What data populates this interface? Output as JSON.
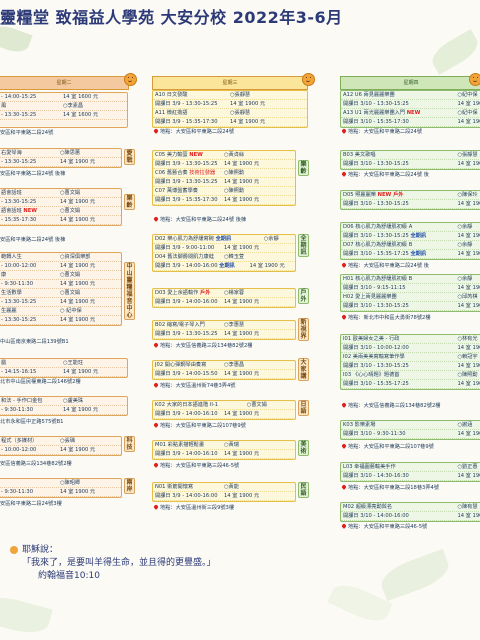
{
  "header": {
    "title": "靈糧堂  致福益人學苑  大安分校  2022年3-6月"
  },
  "columns": [
    {
      "header": "星期二"
    },
    {
      "header": "星期三"
    },
    {
      "header": "星期四"
    }
  ],
  "tuesday": {
    "c1": [
      "- 14:00-15:25",
      "14 室 1600 元"
    ],
    "c1b": [
      "風",
      "○李素昌"
    ],
    "c1c": [
      "- 13:30-15:25",
      "14 室 1600 元"
    ],
    "c1loc": "安區和平東路二段24號",
    "c2": [
      "右愛琴海",
      "○陳思蕙"
    ],
    "c2b": [
      "- 13:30-15:25",
      "14 室 1900 元"
    ],
    "c2loc": "安區和平東路二段24號  後棟",
    "c2side": "愛戰",
    "c3": [
      "語會話班",
      "○曹文娟"
    ],
    "c3b": [
      "- 13:30-15:25",
      "14 室 1900 元"
    ],
    "c3c": [
      "語會話班",
      "○曹文娟"
    ],
    "c3new": "NEW",
    "c3d": [
      "- 15:35-17:30",
      "14 室 1900 元"
    ],
    "c3loc": "安區和平東路二段24號  後棟",
    "c3side": "樂齡",
    "c4": [
      "範轉人生",
      "○資深俱樂部"
    ],
    "c4b": [
      "- 10:00-12:00",
      "14 室 1900 元"
    ],
    "c4c": [
      "康",
      "○曹文娟"
    ],
    "c4d": [
      "- 9:30-11:30",
      "14 室 1900 元"
    ],
    "c4e": [
      "生活數學",
      "○曹文娟"
    ],
    "c4f": [
      "- 13:30-15:25",
      "14 室 1900 元"
    ],
    "c4g": [
      "生麗麗",
      "○ 紀中保"
    ],
    "c4h": [
      "- 13:30-15:25",
      "14 室 1900 元"
    ],
    "c4loc": "中山區南京東路二段139號B1",
    "c4side": "中山靈糧福音中心",
    "c5": [
      "戲",
      "○王能玨"
    ],
    "c5b": [
      "- 14:15-16:15",
      "14 室 1900 元"
    ],
    "c5loc": "北市中山區民權東路二段146號2樓",
    "c6": [
      "和法 - 手作口金包",
      "○盧美珠"
    ],
    "c6b": [
      "- 9:30-11:30",
      "14 室 1900 元"
    ],
    "c6loc": "北市永和區中正路575號B1",
    "c7": [
      "程式（多媒材）",
      "○張瑀"
    ],
    "c7b": [
      "- 10:00-12:00",
      "14 室 1900 元"
    ],
    "c7loc": "安區信義路三段134巷82號2樓",
    "c7side": "科技",
    "c8": [
      "",
      "○陳昭卿"
    ],
    "c8b": [
      "- 9:30-11:30",
      "14 室 1900 元"
    ],
    "c8loc": "安區和平東路二段24號3樓",
    "c8side": "兩岸"
  },
  "wednesday": {
    "a10": [
      "A10 日文發酸",
      "○張靜慧"
    ],
    "a10b": [
      "開課日 3/9 - 13:30-15:25",
      "14 室 1900 元"
    ],
    "a11": [
      "A11 微紅擔語",
      "○張靜慧"
    ],
    "a11b": [
      "開課日 3/9 - 15:35-17:30",
      "14 室 1900 元"
    ],
    "aloc": "地點：大安區和平東路二段24號",
    "c05": [
      "C05 美力輸蛋 ",
      "○黃貞絲"
    ],
    "c05new": "NEW",
    "c05b": [
      "開課日 3/9 - 13:30-15:25",
      "14 室 1900 元"
    ],
    "c06": [
      "C06 舊藝合奏 ",
      "○陳照勳"
    ],
    "c06tag": "技術拉發器",
    "c06b": [
      "開課日 3/9 - 13:30-15:25",
      "14 室 1900 元"
    ],
    "c07": [
      "C07 萬博盤蓄學奏",
      "○陳照勳"
    ],
    "c07b": [
      "開課日 3/9 - 15:35-17:30",
      "14 室 1900 元"
    ],
    "cloc": "地點：大安區和平東路二段24號  後棟",
    "cside": "樂齡",
    "d02": [
      "D02 樂心肌力為舒緩寫碗 ",
      "○余靜"
    ],
    "d02tag": "全期訊",
    "d02b": [
      "開課日 3/9 - 9:00-11:00",
      "14 室 1900 元"
    ],
    "d04": [
      "D04 舊法腳爵閱肌力康蛙 ",
      "○韓玉萱"
    ],
    "d04b": [
      "開課日 3/9 - 14:00-16:00 ",
      "14 室 1900 元"
    ],
    "d04tag": "全期訊",
    "dside": "全期訊",
    "d03": [
      "D03 愛上余語輸作 ",
      "○楊家蓉"
    ],
    "d03tag": "戶外",
    "d03b": [
      "開課日 3/9 - 14:00-16:00",
      "14 室 1900 元"
    ],
    "d03side": "戶外",
    "b02": [
      "B02 縮寫/電子琴入門",
      "○李惠慧"
    ],
    "b02b": [
      "開課日 3/9 - 13:30-15:25",
      "14 室 1900 元"
    ],
    "bloc": "地點：大安區信義路三段134巷82號2樓",
    "bside": "新視界",
    "j02": [
      "J02 開心彈鋼琴由奏寫",
      "○李惠昌"
    ],
    "j02b": [
      "開課日 3/9 - 14:00-15:50",
      "14 室 1900 元"
    ],
    "jloc": "地點：大安區溫州街74巷3弄4號",
    "jside": "大家講",
    "k02": [
      "K02 大家的日本語進階 II-1",
      "○曹文娟"
    ],
    "k02b": [
      "開課日 3/9 - 14:00-16:10",
      "14 室 1900 元"
    ],
    "kloc": "地點：大安區和平東路二段107巷9號",
    "kside": "日語",
    "m01": [
      "M01 彩點素描輕鬆畫",
      "○黃瑞"
    ],
    "m01b": [
      "開課日 3/9 - 14:00-16:10",
      "14 室 1900 元"
    ],
    "mloc": "地點：大安區和平東路三段46-5號",
    "mside": "美術",
    "n01": [
      "N01 衛筋開懷寫",
      "○黃能"
    ],
    "n01b": [
      "開課日 3/9 - 14:00-16:00",
      "14 室 1900 元"
    ],
    "nloc": "地點：大安區溫州街三段9號3樓",
    "nside": "民語"
  },
  "thursday": {
    "a12": [
      "A12 U6 兩見麗麗樂團",
      "○紀中保"
    ],
    "a12b": [
      "開課日 3/10 - 13:30-15:25",
      "14 室 1900"
    ],
    "a13": [
      "A13 U1 兩光麗麗樂團入門 ",
      "○紀中保"
    ],
    "a13new": "NEW",
    "a13b": [
      "開課日 3/10 - 15:35-17:30",
      "14 室 1900"
    ],
    "aloc": "地點：大安區和平東路二段24號",
    "b03": [
      "B03 美文歌唱",
      "○張靜慧"
    ],
    "b03b": [
      "開課日 3/10 - 13:30-15:25",
      "14 室 1900"
    ],
    "bloc": "地點：大安區和平東路二段24號  後",
    "d05": [
      "D05 照麗麗樂 ",
      "○陳保玲"
    ],
    "d05new": "NEW  戶外",
    "d05b": [
      "開課日 3/10 - 13:30-15:25",
      "14 室 1900"
    ],
    "d06": [
      "D06 核心肌力為舒緩肌初級 A",
      "○余靜"
    ],
    "d06b": [
      "開課日 3/10 - 13:30-15:25 ",
      "14 室 1900"
    ],
    "d06tag": "全期訊",
    "d07": [
      "D07 核心肌力為舒緩肌初級 B",
      "○余靜"
    ],
    "d07b": [
      "開課日 3/10 - 15:35-17:25 ",
      "14 室 1900"
    ],
    "d07tag": "全期訊",
    "dloc": "地點：大安區和平東路二段24號  後",
    "h01": [
      "H01 核心肌力為舒緩肌初級 B",
      "○余靜"
    ],
    "h01b": [
      "開課日 3/10 - 9:15-11:15",
      "14 室 1900"
    ],
    "h02": [
      "H02 愛上兩見麗麗樂團",
      "○邱芮棋"
    ],
    "h02b": [
      "開課日 3/10 - 13:30-15:25",
      "14 室 1900"
    ],
    "hloc": "地點：新北市中和區大勇街78號2樓",
    "i01": [
      "I01 歐美婦女之美 - 行政",
      "○林有光"
    ],
    "i01b": [
      "開課日 3/10 - 10:00-12:00",
      "14 室 190"
    ],
    "i02": [
      "I02 美兩美美寫輸寫筆作學",
      "○賴冠宇"
    ],
    "i02b": [
      "開課日 3/10 - 13:30-15:25",
      "14 室 190"
    ],
    "i03": [
      "I03 《心心晴題》題德首",
      "○陳照勳"
    ],
    "i03b": [
      "開課日 3/10 - 15:35-17:25",
      "14 室 190"
    ],
    "iloc": "地點：大安區信義路三段134巷82號2樓",
    "k03": [
      "K03 影樂素場",
      "○謝涵"
    ],
    "k03b": [
      "開課日 3/10 - 9:30-11:30",
      "14 室 190"
    ],
    "kloc": "地點：大安區和平東路二段107巷9號",
    "l03": [
      "L03 幸福圓藝輸美手作",
      "○劉正惠"
    ],
    "l03b": [
      "開課日 3/10 - 14:30-16:30",
      "14 室 190"
    ],
    "lloc": "地點：大安區和平東路二段18巷3弄4號",
    "m02": [
      "M02 超級漂亮勳與名",
      "○陳有慧"
    ],
    "m02b": [
      "開課日 3/10 - 14:00-16:00",
      "14 室 190"
    ],
    "mloc": "地點：大安區和平東路三段46-5號"
  },
  "quote": {
    "speaker": "耶穌說：",
    "text": "「我來了，是要叫羊得生命，並且得的更豐盛。」",
    "ref": "約翰福音10:10"
  },
  "colors": {
    "title": "#2d3a78",
    "orange": "#e0a65c",
    "yellow": "#e6bf4a",
    "green": "#8fbb6c",
    "new": "#e0201c"
  }
}
